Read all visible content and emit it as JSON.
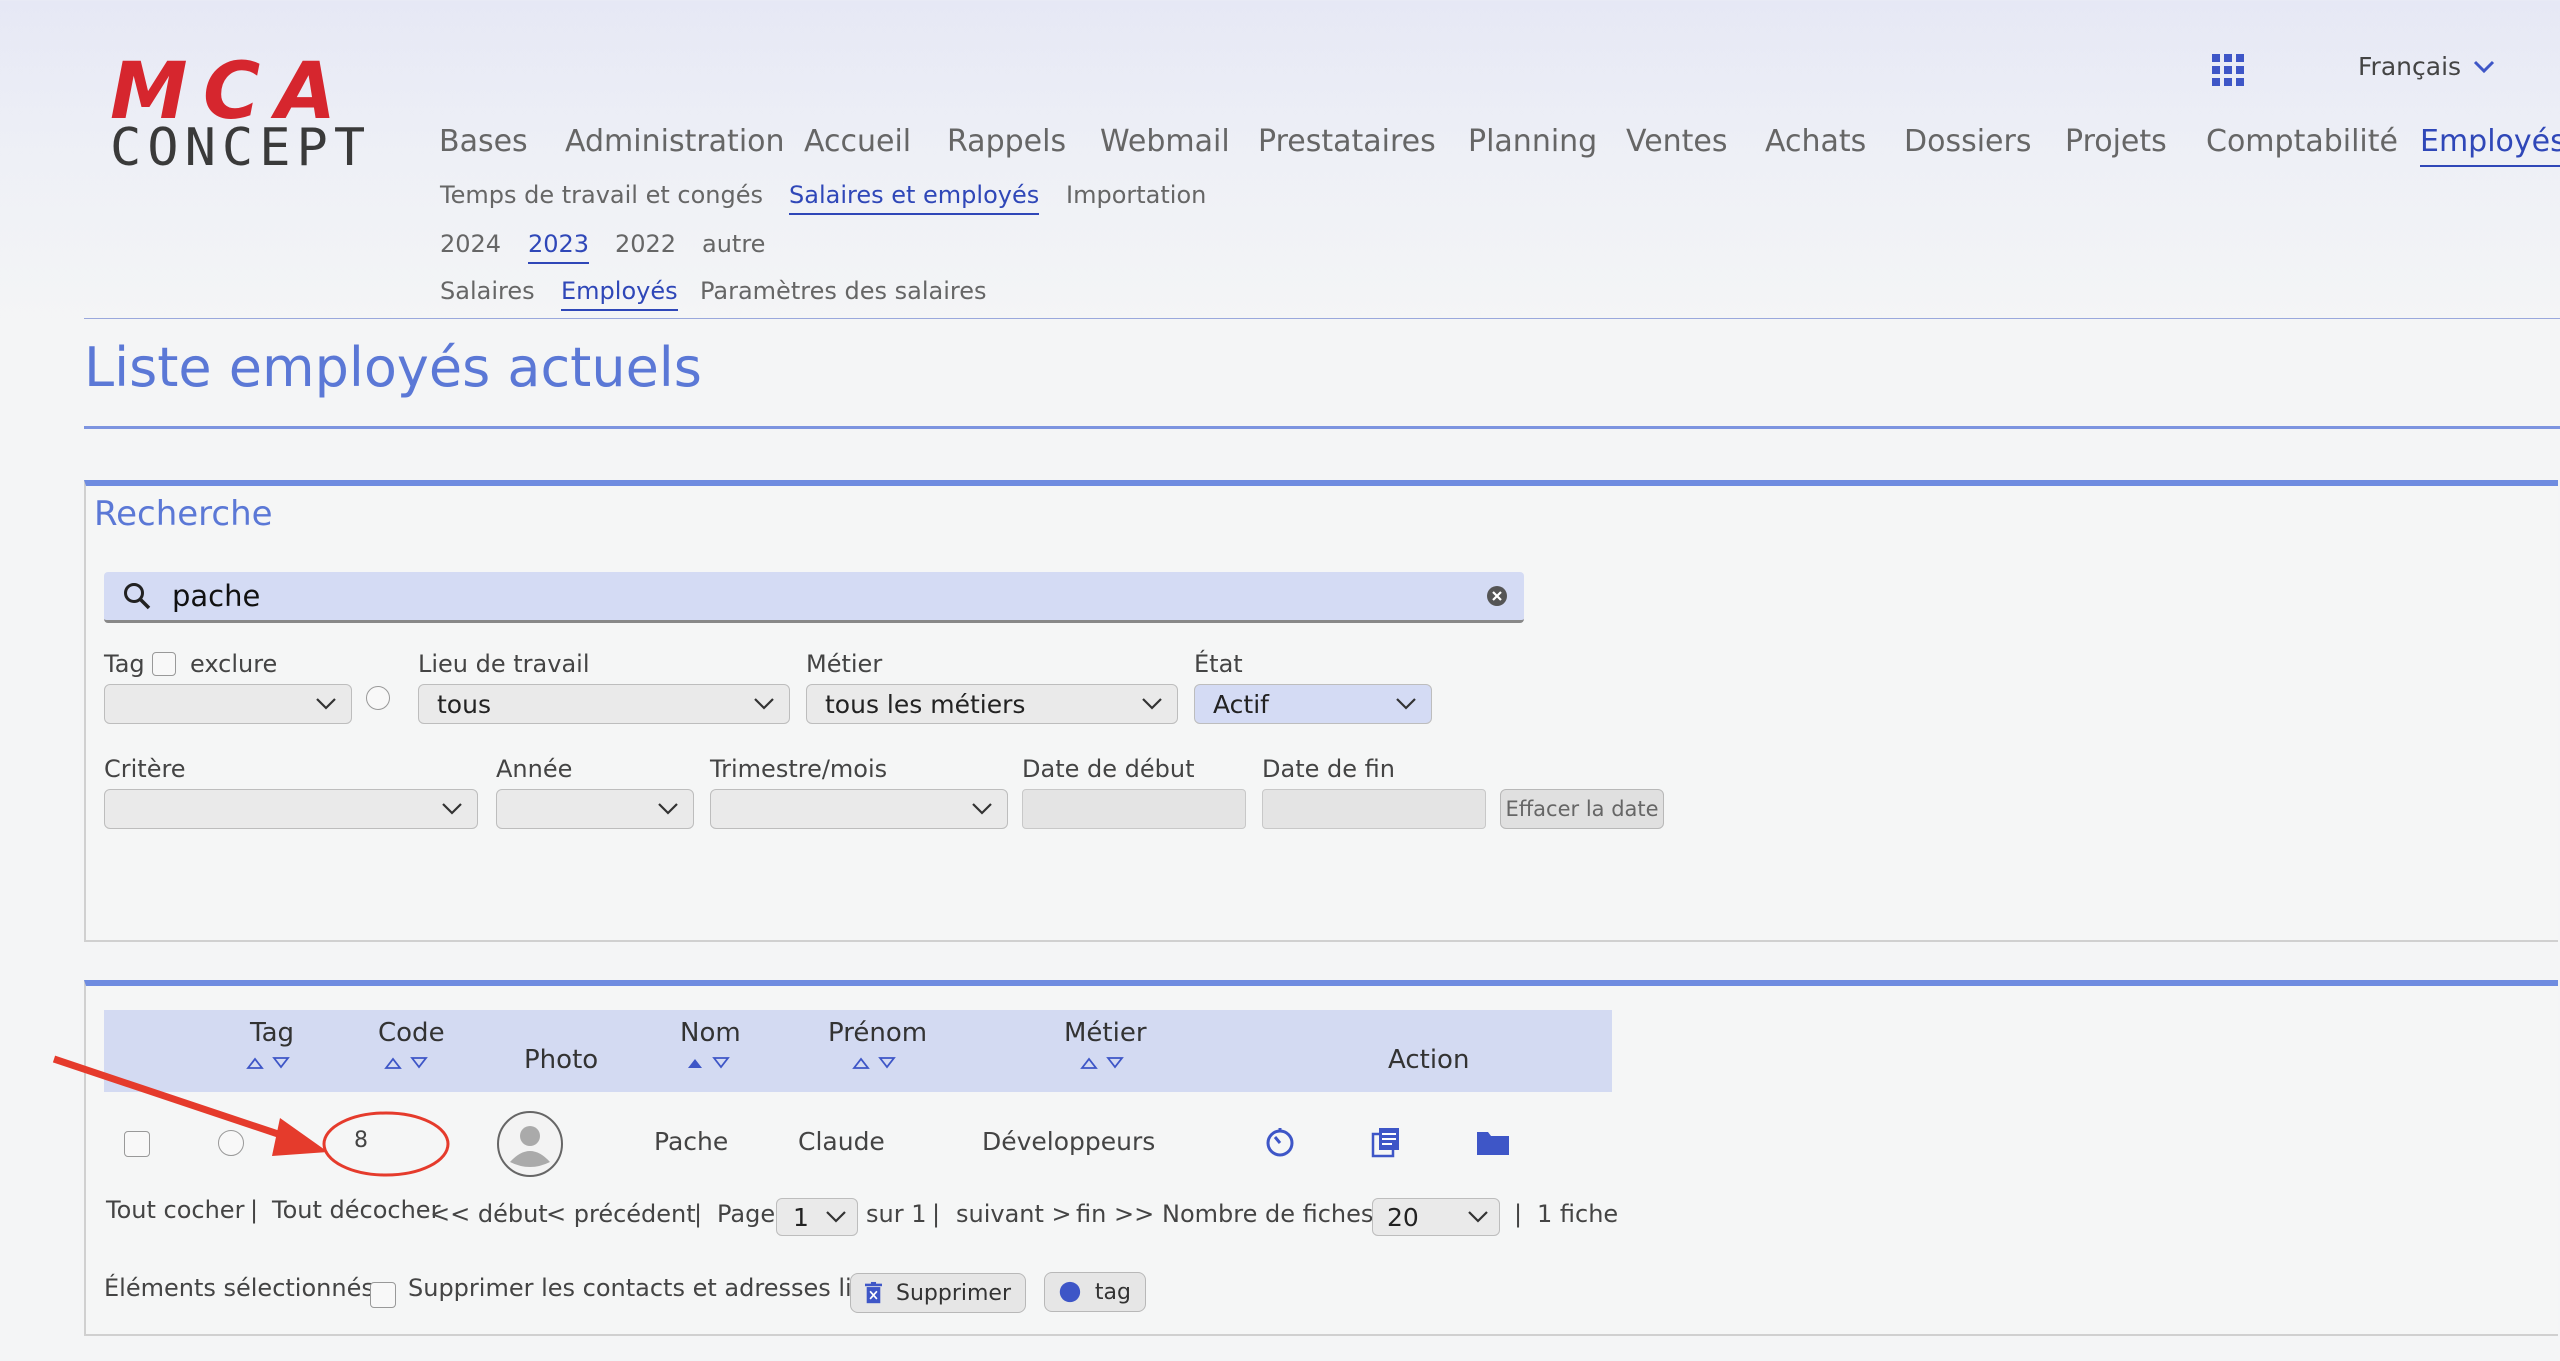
{
  "brand": {
    "logo_top": "MCA",
    "logo_bottom": "CONCEPT",
    "color": "#d6262e"
  },
  "header": {
    "language": "Français",
    "main_nav": [
      "Bases",
      "Administration",
      "Accueil",
      "Rappels",
      "Webmail",
      "Prestataires",
      "Planning",
      "Ventes",
      "Achats",
      "Dossiers",
      "Projets",
      "Comptabilité",
      "Employés"
    ],
    "active_main": "Employés",
    "sub_nav": [
      "Temps de travail et congés",
      "Salaires et employés",
      "Importation"
    ],
    "years": [
      "2024",
      "2023",
      "2022",
      "autre"
    ],
    "section_nav": [
      "Salaires",
      "Employés",
      "Paramètres des salaires"
    ]
  },
  "page": {
    "title": "Liste employés actuels"
  },
  "search": {
    "title": "Recherche",
    "query": "pache",
    "tag_label": "Tag",
    "exclude_label": "exclure",
    "workplace_label": "Lieu de travail",
    "workplace_value": "tous",
    "job_label": "Métier",
    "job_value": "tous les métiers",
    "state_label": "État",
    "state_value": "Actif",
    "criteria_label": "Critère",
    "year_label": "Année",
    "quarter_label": "Trimestre/mois",
    "start_label": "Date de début",
    "end_label": "Date de fin",
    "clear_date": "Effacer la date"
  },
  "table": {
    "headers": {
      "tag": "Tag",
      "code": "Code",
      "photo": "Photo",
      "nom": "Nom",
      "prenom": "Prénom",
      "metier": "Métier",
      "action": "Action"
    },
    "rows": [
      {
        "code": "8",
        "nom": "Pache",
        "prenom": "Claude",
        "metier": "Développeurs"
      }
    ]
  },
  "pagination": {
    "check_all": "Tout cocher",
    "sep": "|",
    "uncheck_all": "Tout décocher",
    "first": "<< début",
    "prev": "< précédent",
    "page_label": "Page",
    "page_value": "1",
    "of": "sur 1",
    "next": "suivant >",
    "last": "fin >>",
    "per_page_label": "Nombre de fiches",
    "per_page_value": "20",
    "count": "1 fiche"
  },
  "bulk": {
    "selected_label": "Éléments sélectionnés:",
    "delete_linked": "Supprimer les contacts et adresses liés",
    "delete_button": "Supprimer",
    "tag_button": "tag"
  },
  "colors": {
    "accent": "#2f47b8",
    "title": "#5b78d6",
    "annotation": "#e53b2c"
  }
}
